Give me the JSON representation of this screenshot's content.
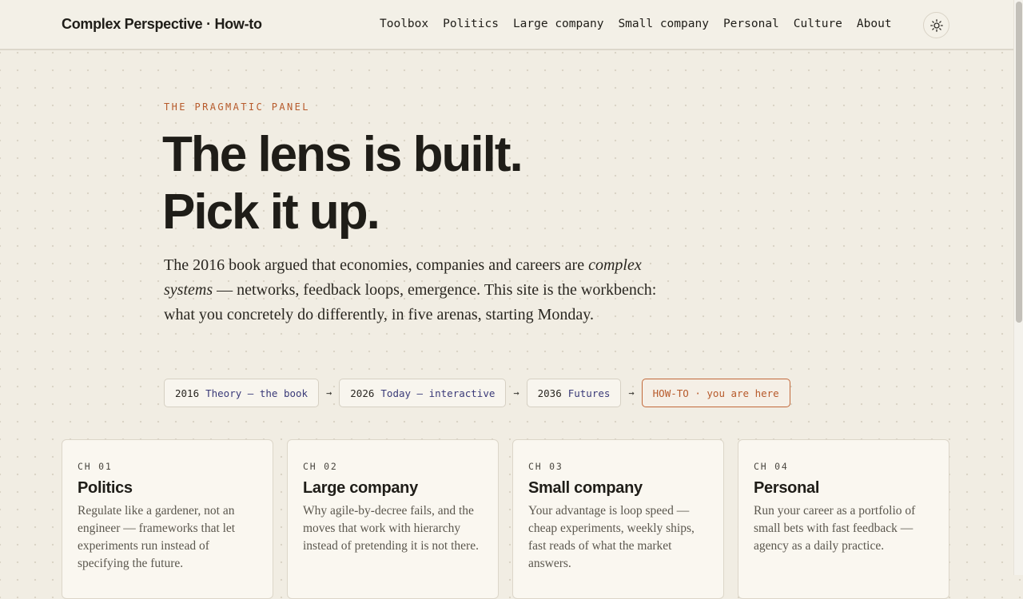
{
  "header": {
    "brand": "Complex Perspective · How-to",
    "nav": [
      "Toolbox",
      "Politics",
      "Large company",
      "Small company",
      "Personal",
      "Culture",
      "About"
    ],
    "theme_icon": "sun-icon"
  },
  "hero": {
    "eyebrow": "THE PRAGMATIC PANEL",
    "headline_line1": "The lens is built.",
    "headline_line2": "Pick it up.",
    "intro_before": "The 2016 book argued that economies, companies and careers are ",
    "intro_em": "complex systems",
    "intro_after": " — networks, feedback loops, emergence. This site is the workbench: what you concretely do differently, in five arenas, starting Monday."
  },
  "timeline": {
    "items": [
      {
        "year": "2016",
        "label": "Theory — the book"
      },
      {
        "year": "2026",
        "label": "Today — interactive"
      },
      {
        "year": "2036",
        "label": "Futures"
      }
    ],
    "arrow": "→",
    "current": "HOW-TO · you are here"
  },
  "chapters": [
    {
      "ch": "CH 01",
      "title": "Politics",
      "desc": "Regulate like a gardener, not an engineer — frameworks that let experiments run instead of specifying the future."
    },
    {
      "ch": "CH 02",
      "title": "Large company",
      "desc": "Why agile-by-decree fails, and the moves that work with hierarchy instead of pretending it is not there."
    },
    {
      "ch": "CH 03",
      "title": "Small company",
      "desc": "Your advantage is loop speed — cheap experiments, weekly ships, fast reads of what the market answers."
    },
    {
      "ch": "CH 04",
      "title": "Personal",
      "desc": "Run your career as a portfolio of small bets with fast feedback — agency as a daily practice."
    }
  ],
  "colors": {
    "accent": "#b75a2b",
    "link": "#3a3a78",
    "background": "#f1ede3"
  }
}
